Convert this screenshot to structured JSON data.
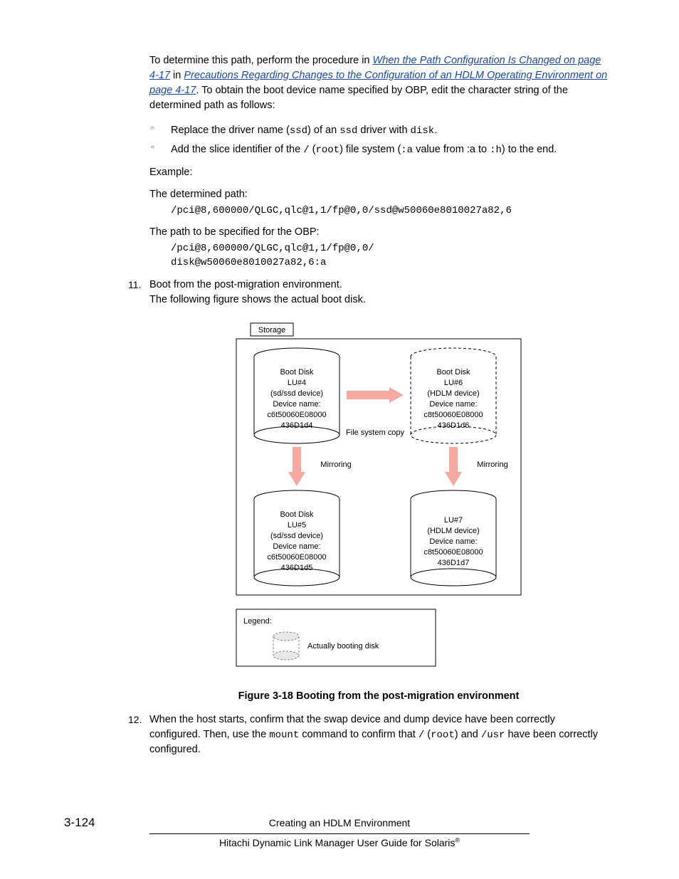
{
  "para1_pre": "To determine this path, perform the procedure in ",
  "link1": "When the Path Configuration Is Changed on page 4-17",
  "para1_mid": " in ",
  "link2": "Precautions Regarding Changes to the Configuration of an HDLM Operating Environment on page 4-17",
  "para1_post": ". To obtain the boot device name specified by OBP, edit the character string of the determined path as follows:",
  "bullet1_a": "Replace the driver name (",
  "bullet1_b": "ssd",
  "bullet1_c": ") of an ",
  "bullet1_d": "ssd",
  "bullet1_e": " driver with ",
  "bullet1_f": "disk",
  "bullet1_g": ".",
  "bullet2_a": "Add the slice identifier of the ",
  "bullet2_b": "/",
  "bullet2_c": " (",
  "bullet2_d": "root",
  "bullet2_e": ") file system (",
  "bullet2_f": ":a",
  "bullet2_g": " value from :a to ",
  "bullet2_h": ":h",
  "bullet2_i": ") to the end.",
  "example_label": "Example:",
  "det_path_label": "The determined path:",
  "det_path_code": "/pci@8,600000/QLGC,qlc@1,1/fp@0,0/ssd@w50060e8010027a82,6",
  "obp_path_label": "The path to be specified for the OBP:",
  "obp_path_code": "/pci@8,600000/QLGC,qlc@1,1/fp@0,0/\ndisk@w50060e8010027a82,6:a",
  "step11_num": "11.",
  "step11_l1": "Boot from the post-migration environment.",
  "step11_l2": "The following figure shows the actual boot disk.",
  "fig": {
    "storage_label": "Storage",
    "fs_copy": "File system copy",
    "mirroring": "Mirroring",
    "legend": "Legend:",
    "legend_text": "Actually booting disk",
    "disk1": {
      "l1": "Boot Disk",
      "l2": "LU#4",
      "l3": "(sd/ssd device)",
      "l4": "Device name:",
      "l5": "c6t50060E08000",
      "l6": "436D1d4"
    },
    "disk2": {
      "l1": "Boot Disk",
      "l2": "LU#6",
      "l3": "(HDLM device)",
      "l4": "Device name:",
      "l5": "c8t50060E08000",
      "l6": "436D1d6"
    },
    "disk3": {
      "l1": "Boot Disk",
      "l2": "LU#5",
      "l3": "(sd/ssd device)",
      "l4": "Device name:",
      "l5": "c6t50060E08000",
      "l6": "436D1d5"
    },
    "disk4": {
      "l1": "LU#7",
      "l2": "(HDLM device)",
      "l3": "Device name:",
      "l4": "c8t50060E08000",
      "l5": "436D1d7"
    }
  },
  "fig_caption": "Figure 3-18 Booting from the post-migration environment",
  "step12_num": "12.",
  "step12_a": "When the host starts, confirm that the swap device and dump device have been correctly configured. Then, use the ",
  "step12_b": "mount",
  "step12_c": " command to confirm that ",
  "step12_d": "/",
  "step12_e": " (",
  "step12_f": "root",
  "step12_g": ") and ",
  "step12_h": "/usr",
  "step12_i": " have been correctly configured.",
  "page_num": "3-124",
  "chapter": "Creating an HDLM Environment",
  "doc_title_a": "Hitachi Dynamic Link Manager User Guide for Solaris",
  "doc_title_b": "®"
}
